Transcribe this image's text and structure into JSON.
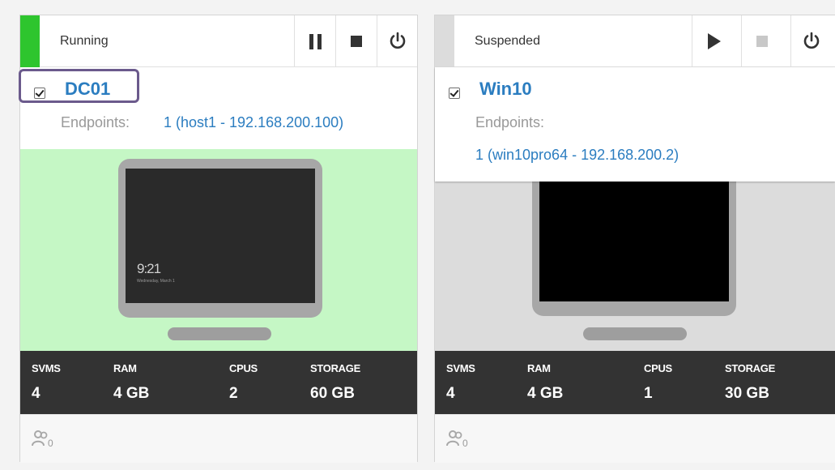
{
  "vms": [
    {
      "status": "Running",
      "status_color": "#2ec52e",
      "screen_bg": "#c5f7c5",
      "controls": [
        "pause-icon",
        "stop-icon",
        "power-icon"
      ],
      "name": "DC01",
      "checked": true,
      "endpoints_label": "Endpoints:",
      "endpoints_value": "1 (host1 - 192.168.200.100)",
      "lock_time": "9:21",
      "lock_sub": "Wednesday, March 1",
      "stats": {
        "svms_label": "SVMS",
        "svms": "4",
        "ram_label": "RAM",
        "ram": "4 GB",
        "cpus_label": "CPUS",
        "cpus": "2",
        "storage_label": "STORAGE",
        "storage": "60 GB"
      },
      "users_count": "0"
    },
    {
      "status": "Suspended",
      "status_color": "#dcdcdc",
      "screen_bg": "#dcdcdc",
      "controls": [
        "play-icon",
        "stop-icon-disabled",
        "power-icon"
      ],
      "name": "Win10",
      "checked": true,
      "endpoints_label": "Endpoints:",
      "endpoints_value": "1 (win10pro64 - 192.168.200.2)",
      "stats": {
        "svms_label": "SVMS",
        "svms": "4",
        "ram_label": "RAM",
        "ram": "4 GB",
        "cpus_label": "CPUS",
        "cpus": "1",
        "storage_label": "STORAGE",
        "storage": "30 GB"
      },
      "users_count": "0"
    }
  ]
}
